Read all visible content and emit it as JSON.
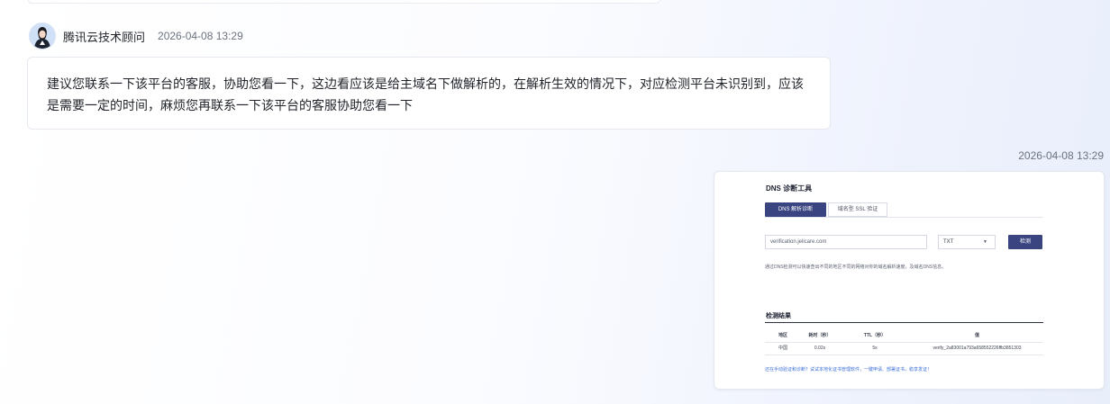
{
  "agent": {
    "name": "腾讯云技术顾问",
    "time": "2026-04-08 13:29",
    "message_line1": "建议您联系一下该平台的客服，协助您看一下，这边看应该是给主域名下做解析的，在解析生效的情况下，对应检测平台未识别到，应该",
    "message_line2": "是需要一定的时间，麻烦您再联系一下该平台的客服协助您看一下"
  },
  "user": {
    "time": "2026-04-08 13:29",
    "screenshot": {
      "title": "DNS 诊断工具",
      "tabs": [
        "DNS 解析诊断",
        "域名型 SSL 验证"
      ],
      "domain_value": "verification.jelicare.com",
      "record_type": "TXT",
      "check_label": "检测",
      "description": "通过DNS检测可以快速查出不同的地区不同的网络对你的域名解析速度，及域名DNS信息。",
      "result_title": "检测结果",
      "columns": [
        "地区",
        "耗时（秒）",
        "TTL（秒）",
        "值"
      ],
      "rows": [
        [
          "中国",
          "0.02s",
          "5s",
          "verify_2a83001a793a658552226ffb3851303"
        ]
      ],
      "footer": "还在手动验证和诊断？试试本地化证书管理软件，一键申请、部署证书，稳享发证！"
    }
  },
  "colors": {
    "accent": "#3a4480",
    "link": "#3b6fd6"
  }
}
